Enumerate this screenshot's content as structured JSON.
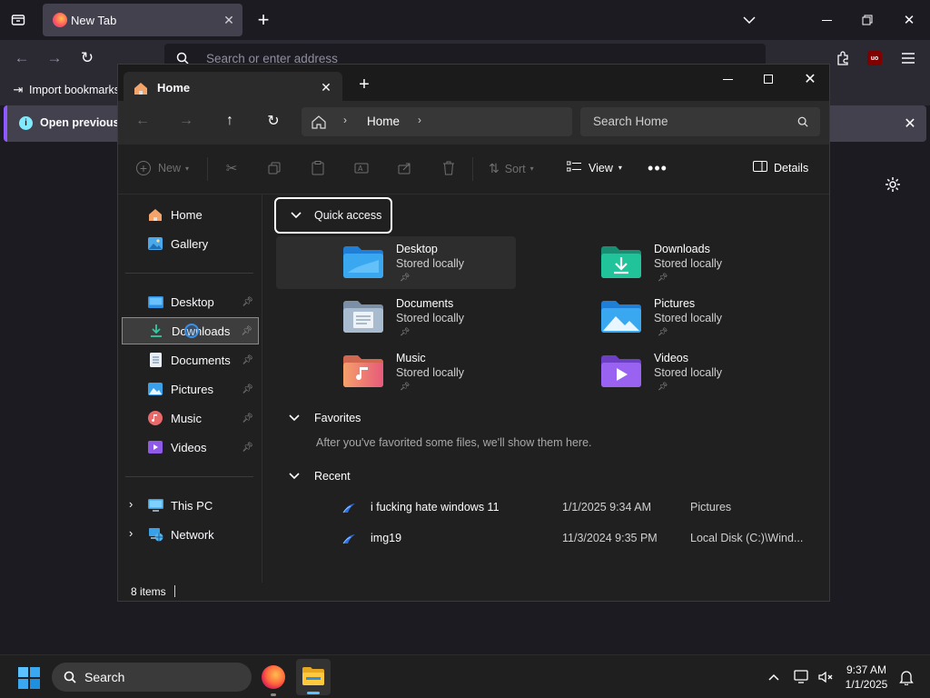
{
  "browser": {
    "tab_title": "New Tab",
    "address_placeholder": "Search or enter address",
    "bookmarks_import": "Import bookmarks",
    "notification_text": "Open previous ta"
  },
  "explorer": {
    "tab_title": "Home",
    "breadcrumb_home": "Home",
    "search_placeholder": "Search Home",
    "toolbar": {
      "new": "New",
      "sort": "Sort",
      "view": "View",
      "details": "Details"
    },
    "nav": {
      "home": "Home",
      "gallery": "Gallery",
      "desktop": "Desktop",
      "downloads": "Downloads",
      "documents": "Documents",
      "pictures": "Pictures",
      "music": "Music",
      "videos": "Videos",
      "this_pc": "This PC",
      "network": "Network"
    },
    "quick_access_label": "Quick access",
    "folders": [
      {
        "name": "Desktop",
        "sub": "Stored locally"
      },
      {
        "name": "Downloads",
        "sub": "Stored locally"
      },
      {
        "name": "Documents",
        "sub": "Stored locally"
      },
      {
        "name": "Pictures",
        "sub": "Stored locally"
      },
      {
        "name": "Music",
        "sub": "Stored locally"
      },
      {
        "name": "Videos",
        "sub": "Stored locally"
      }
    ],
    "favorites_label": "Favorites",
    "favorites_empty": "After you've favorited some files, we'll show them here.",
    "recent_label": "Recent",
    "recent": [
      {
        "name": "i fucking hate windows 11",
        "date": "1/1/2025 9:34 AM",
        "location": "Pictures"
      },
      {
        "name": "img19",
        "date": "11/3/2024 9:35 PM",
        "location": "Local Disk (C:)\\Wind..."
      }
    ],
    "status": "8 items"
  },
  "taskbar": {
    "search_label": "Search",
    "time": "9:37 AM",
    "date": "1/1/2025"
  },
  "colors": {
    "accent": "#9059ff",
    "folder_blue": "#3aa0e8",
    "downloads_teal": "#1fb38f"
  }
}
